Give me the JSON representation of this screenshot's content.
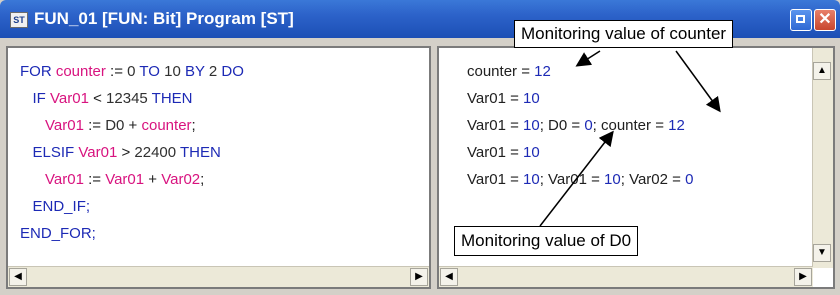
{
  "window": {
    "app_icon_text": "ST",
    "title": "FUN_01 [FUN: Bit] Program [ST]",
    "close_glyph": "✕",
    "icons": [
      "st-app-icon",
      "restore-icon",
      "close-icon",
      "scroll-left-icon",
      "scroll-right-icon",
      "scroll-up-icon",
      "scroll-down-icon"
    ]
  },
  "code_lines": [
    {
      "indent": "",
      "tokens": [
        {
          "t": "FOR ",
          "c": "kw"
        },
        {
          "t": "counter",
          "c": "var"
        },
        {
          "t": " := ",
          "c": "op"
        },
        {
          "t": "0",
          "c": "num"
        },
        {
          "t": " TO ",
          "c": "kw"
        },
        {
          "t": "10",
          "c": "num"
        },
        {
          "t": " BY ",
          "c": "kw"
        },
        {
          "t": "2",
          "c": "num"
        },
        {
          "t": " DO",
          "c": "kw"
        }
      ]
    },
    {
      "indent": "   ",
      "tokens": [
        {
          "t": "IF ",
          "c": "kw"
        },
        {
          "t": "Var01",
          "c": "var"
        },
        {
          "t": " < ",
          "c": "op"
        },
        {
          "t": "12345",
          "c": "num"
        },
        {
          "t": " THEN",
          "c": "kw"
        }
      ]
    },
    {
      "indent": "      ",
      "tokens": [
        {
          "t": "Var01",
          "c": "var"
        },
        {
          "t": " := ",
          "c": "op"
        },
        {
          "t": "D0",
          "c": "num"
        },
        {
          "t": " + ",
          "c": "op"
        },
        {
          "t": "counter",
          "c": "var"
        },
        {
          "t": ";",
          "c": "op"
        }
      ]
    },
    {
      "indent": "   ",
      "tokens": [
        {
          "t": "ELSIF ",
          "c": "kw"
        },
        {
          "t": "Var01",
          "c": "var"
        },
        {
          "t": " > ",
          "c": "op"
        },
        {
          "t": "22400",
          "c": "num"
        },
        {
          "t": " THEN",
          "c": "kw"
        }
      ]
    },
    {
      "indent": "      ",
      "tokens": [
        {
          "t": "Var01",
          "c": "var"
        },
        {
          "t": " := ",
          "c": "op"
        },
        {
          "t": "Var01",
          "c": "var"
        },
        {
          "t": " + ",
          "c": "op"
        },
        {
          "t": "Var02",
          "c": "var"
        },
        {
          "t": ";",
          "c": "op"
        }
      ]
    },
    {
      "indent": "   ",
      "tokens": [
        {
          "t": "END_IF;",
          "c": "kw"
        }
      ]
    },
    {
      "indent": "",
      "tokens": [
        {
          "t": "END_FOR;",
          "c": "kw"
        }
      ]
    }
  ],
  "monitor_lines": [
    [
      {
        "t": "counter = ",
        "c": "op"
      },
      {
        "t": "12",
        "c": "val"
      }
    ],
    [
      {
        "t": "Var01 = ",
        "c": "op"
      },
      {
        "t": "10",
        "c": "val"
      }
    ],
    [
      {
        "t": "Var01 = ",
        "c": "op"
      },
      {
        "t": "10",
        "c": "val"
      },
      {
        "t": "; D0 = ",
        "c": "op"
      },
      {
        "t": "0",
        "c": "val"
      },
      {
        "t": "; counter = ",
        "c": "op"
      },
      {
        "t": "12",
        "c": "val"
      }
    ],
    [
      {
        "t": "Var01 = ",
        "c": "op"
      },
      {
        "t": "10",
        "c": "val"
      }
    ],
    [
      {
        "t": "Var01 = ",
        "c": "op"
      },
      {
        "t": "10",
        "c": "val"
      },
      {
        "t": "; Var01 = ",
        "c": "op"
      },
      {
        "t": "10",
        "c": "val"
      },
      {
        "t": "; Var02 = ",
        "c": "op"
      },
      {
        "t": "0",
        "c": "val"
      }
    ]
  ],
  "callouts": {
    "counter": "Monitoring value of counter",
    "d0": "Monitoring value of D0"
  },
  "colors": {
    "keyword": "#1d2ab5",
    "variable": "#d8137f",
    "monitor_value": "#1d2ab5",
    "titlebar": "#2c62c9"
  }
}
